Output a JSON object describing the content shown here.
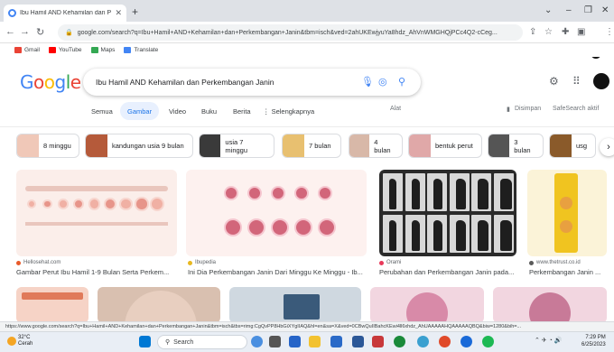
{
  "browser": {
    "tab_title": "Ibu Hamil AND Kehamilan dan P",
    "tab_close": "✕",
    "new_tab": "+",
    "window_controls": [
      "⌄",
      "–",
      "❐",
      "✕"
    ],
    "url": "google.com/search?q=Ibu+Hamil+AND+Kehamilan+dan+Perkembangan+Janin&tbm=isch&ved=2ahUKEwjyuYa8hdz_AhVnWMGHQjPCc4Q2-cCeg...",
    "bookmarks": [
      {
        "label": "Gmail",
        "color": "#ea4335"
      },
      {
        "label": "YouTube",
        "color": "#ff0000"
      },
      {
        "label": "Maps",
        "color": "#34a853"
      },
      {
        "label": "Translate",
        "color": "#4285f4"
      }
    ]
  },
  "google": {
    "logo_letters": [
      {
        "ch": "G",
        "color": "#4285f4"
      },
      {
        "ch": "o",
        "color": "#ea4335"
      },
      {
        "ch": "o",
        "color": "#fbbc05"
      },
      {
        "ch": "g",
        "color": "#4285f4"
      },
      {
        "ch": "l",
        "color": "#34a853"
      },
      {
        "ch": "e",
        "color": "#ea4335"
      }
    ],
    "query": "Ibu Hamil AND Kehamilan dan Perkembangan Janin",
    "tabs": [
      "Semua",
      "Gambar",
      "Video",
      "Buku",
      "Berita",
      "⋮ Selengkapnya"
    ],
    "active_tab": "Gambar",
    "tools": "Alat",
    "saved": "Disimpan",
    "safesearch": "SafeSearch aktif"
  },
  "chips": [
    {
      "label": "8 minggu",
      "thumb": "#f0c8b8"
    },
    {
      "label": "kandungan usia 9 bulan",
      "thumb": "#b55a3a"
    },
    {
      "label": "usia 7 minggu",
      "thumb": "#3a3a3a"
    },
    {
      "label": "7 bulan",
      "thumb": "#e8c070"
    },
    {
      "label": "4 bulan",
      "thumb": "#d8b8a8"
    },
    {
      "label": "bentuk perut",
      "thumb": "#e0a8a8"
    },
    {
      "label": "3 bulan",
      "thumb": "#555555"
    },
    {
      "label": "usg",
      "thumb": "#8a5a2a"
    }
  ],
  "results": [
    {
      "source": "Hellosehat.com",
      "title": "Gambar Perut Ibu Hamil 1-9 Bulan Serta Perkem...",
      "dot": "#e85a2a"
    },
    {
      "source": "Ibupedia",
      "title": "Ini Dia Perkembangan Janin Dari Minggu Ke Minggu - Ib...",
      "dot": "#e8b820"
    },
    {
      "source": "Orami",
      "title": "Perubahan dan Perkembangan Janin pada...",
      "dot": "#e83a5a"
    },
    {
      "source": "www.thetrust.co.id",
      "title": "Perkembangan Janin ...",
      "dot": "#5a5a5a"
    }
  ],
  "status_url": "https://www.google.com/search?q=Ibu+Hamil+AND+Kehamilan+dan+Perkembangan+Janin&tbm=isch&tbs=rimg:CgQvPP8HbGiXYgIIAQ&hl=en&sa=X&ved=0CBwQuIIBahcKEwi4ll6xhdz_AhUAAAAAHQAAAAAQBQ&biw=1280&bih=...",
  "taskbar": {
    "weather_temp": "32°C",
    "weather_desc": "Cerah",
    "search_label": "Search",
    "time": "7:29 PM",
    "date": "6/25/2023"
  }
}
